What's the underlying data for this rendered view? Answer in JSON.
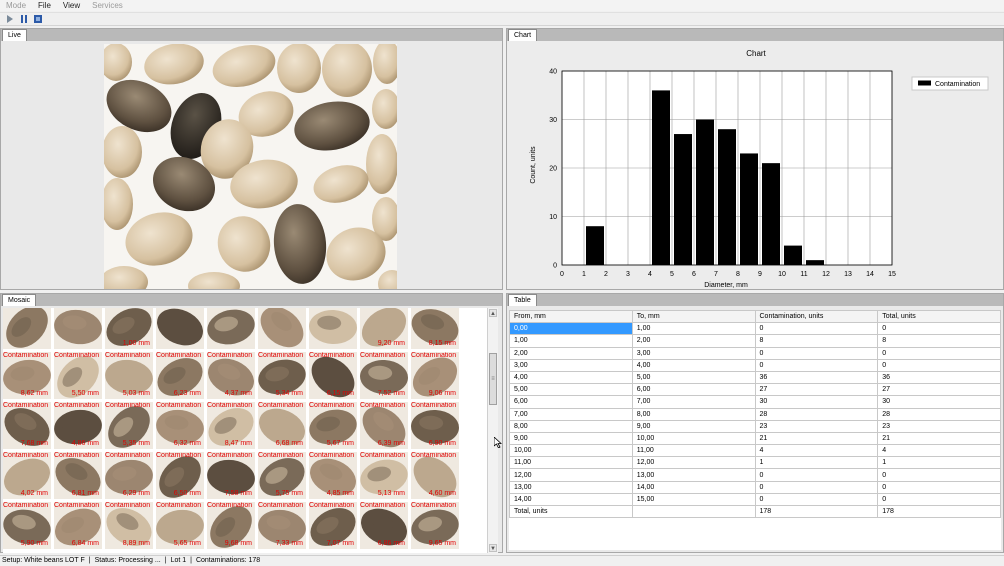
{
  "menu": {
    "items": [
      {
        "label": "Mode",
        "disabled": true
      },
      {
        "label": "File",
        "disabled": false
      },
      {
        "label": "View",
        "disabled": false
      },
      {
        "label": "Services",
        "disabled": true
      }
    ]
  },
  "toolbar": {
    "buttons": [
      {
        "icon": "play-icon"
      },
      {
        "icon": "pause-icon"
      },
      {
        "icon": "stop-icon"
      }
    ]
  },
  "live": {
    "tab_label": "Live"
  },
  "chart_panel": {
    "tab_label": "Chart"
  },
  "chart_data": {
    "type": "bar",
    "title": "Chart",
    "xlabel": "Diameter, mm",
    "ylabel": "Count, units",
    "xlim": [
      0,
      15
    ],
    "ylim": [
      0,
      40
    ],
    "xticks": [
      0,
      1,
      2,
      3,
      4,
      5,
      6,
      7,
      8,
      9,
      10,
      11,
      12,
      13,
      14,
      15
    ],
    "yticks": [
      0,
      10,
      20,
      30,
      40
    ],
    "grid": true,
    "legend_position": "top-right",
    "series": [
      {
        "name": "Contamination",
        "color": "#000000",
        "bins": [
          {
            "from": 0,
            "to": 1,
            "value": 0
          },
          {
            "from": 1,
            "to": 2,
            "value": 8
          },
          {
            "from": 2,
            "to": 3,
            "value": 0
          },
          {
            "from": 3,
            "to": 4,
            "value": 0
          },
          {
            "from": 4,
            "to": 5,
            "value": 36
          },
          {
            "from": 5,
            "to": 6,
            "value": 27
          },
          {
            "from": 6,
            "to": 7,
            "value": 30
          },
          {
            "from": 7,
            "to": 8,
            "value": 28
          },
          {
            "from": 8,
            "to": 9,
            "value": 23
          },
          {
            "from": 9,
            "to": 10,
            "value": 21
          },
          {
            "from": 10,
            "to": 11,
            "value": 4
          },
          {
            "from": 11,
            "to": 12,
            "value": 1
          },
          {
            "from": 12,
            "to": 13,
            "value": 0
          },
          {
            "from": 13,
            "to": 14,
            "value": 0
          },
          {
            "from": 14,
            "to": 15,
            "value": 0
          }
        ]
      }
    ]
  },
  "mosaic": {
    "tab_label": "Mosaic",
    "label": "Contamination",
    "rows": [
      [
        "",
        "",
        "1,00 mm",
        "",
        "",
        "",
        "",
        "9,20 mm",
        "8,15 mm"
      ],
      [
        "8,62 mm",
        "5,50 mm",
        "5,03 mm",
        "6,23 mm",
        "4,37 mm",
        "5,34 mm",
        "6,15 mm",
        "7,52 mm",
        "9,06 mm"
      ],
      [
        "7,68 mm",
        "4,86 mm",
        "5,35 mm",
        "6,32 mm",
        "8,47 mm",
        "6,68 mm",
        "5,67 mm",
        "6,39 mm",
        "6,90 mm"
      ],
      [
        "4,02 mm",
        "6,81 mm",
        "6,29 mm",
        "6,50 mm",
        "7,58 mm",
        "5,75 mm",
        "4,85 mm",
        "5,13 mm",
        "4,60 mm"
      ],
      [
        "5,90 mm",
        "6,84 mm",
        "8,89 mm",
        "5,65 mm",
        "9,68 mm",
        "7,33 mm",
        "7,07 mm",
        "6,86 mm",
        "9,65 mm"
      ]
    ],
    "scroll": {
      "up": "▲",
      "down": "▼",
      "grip": "≡"
    }
  },
  "table": {
    "tab_label": "Table",
    "headers": [
      "From, mm",
      "To, mm",
      "Contamination, units",
      "Total, units"
    ],
    "rows": [
      [
        "0,00",
        "1,00",
        "0",
        "0"
      ],
      [
        "1,00",
        "2,00",
        "8",
        "8"
      ],
      [
        "2,00",
        "3,00",
        "0",
        "0"
      ],
      [
        "3,00",
        "4,00",
        "0",
        "0"
      ],
      [
        "4,00",
        "5,00",
        "36",
        "36"
      ],
      [
        "5,00",
        "6,00",
        "27",
        "27"
      ],
      [
        "6,00",
        "7,00",
        "30",
        "30"
      ],
      [
        "7,00",
        "8,00",
        "28",
        "28"
      ],
      [
        "8,00",
        "9,00",
        "23",
        "23"
      ],
      [
        "9,00",
        "10,00",
        "21",
        "21"
      ],
      [
        "10,00",
        "11,00",
        "4",
        "4"
      ],
      [
        "11,00",
        "12,00",
        "1",
        "1"
      ],
      [
        "12,00",
        "13,00",
        "0",
        "0"
      ],
      [
        "13,00",
        "14,00",
        "0",
        "0"
      ],
      [
        "14,00",
        "15,00",
        "0",
        "0"
      ]
    ],
    "total_row": [
      "Total, units",
      "",
      "178",
      "178"
    ]
  },
  "status": {
    "setup": "Setup: White beans LOT F",
    "sep": "|",
    "state": "Status: Processing ...",
    "lot": "Lot 1",
    "contaminations": "Contaminations: 178"
  }
}
